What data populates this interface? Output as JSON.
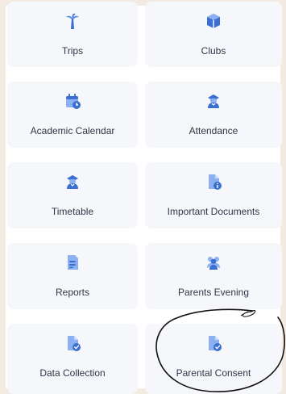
{
  "tiles": [
    {
      "label": "Trips",
      "icon": "palm-tree-icon"
    },
    {
      "label": "Clubs",
      "icon": "cube-icon"
    },
    {
      "label": "Academic Calendar",
      "icon": "calendar-clock-icon"
    },
    {
      "label": "Attendance",
      "icon": "graduate-user-icon"
    },
    {
      "label": "Timetable",
      "icon": "graduate-user-icon"
    },
    {
      "label": "Important Documents",
      "icon": "document-info-icon"
    },
    {
      "label": "Reports",
      "icon": "report-document-icon"
    },
    {
      "label": "Parents Evening",
      "icon": "users-group-icon"
    },
    {
      "label": "Data Collection",
      "icon": "document-check-icon"
    },
    {
      "label": "Parental Consent",
      "icon": "document-check-icon"
    }
  ],
  "colors": {
    "background": "#f3ebe2",
    "tile": "#f6f7fa",
    "icon": "#5b8fe8",
    "icon_dark": "#3b6fd0",
    "text": "#2f3747",
    "annotation": "#111111"
  }
}
